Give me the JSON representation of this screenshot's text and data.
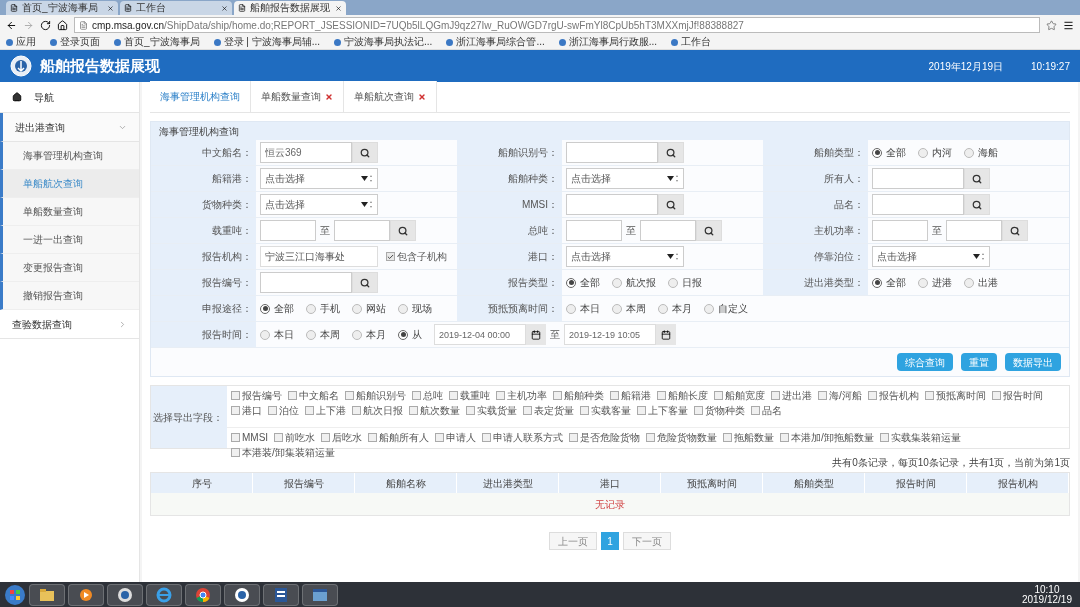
{
  "browser": {
    "tabs": [
      {
        "title": "首页_宁波海事局",
        "selected": false
      },
      {
        "title": "工作台",
        "selected": false
      },
      {
        "title": "船舶报告数据展现",
        "selected": true
      }
    ],
    "url_host": "cmp.msa.gov.cn",
    "url_path": "/ShipData/ship/home.do;REPORT_JSESSIONID=7UQb5lLQGmJ9qz27Iw_RuOWGD7rgU-swFmYl8CpUb5hT3MXXmjJf!88388827",
    "bookmarks": [
      "应用",
      "登录页面",
      "首页_宁波海事局",
      "登录 | 宁波海事局辅...",
      "宁波海事局执法记...",
      "浙江海事局综合管...",
      "浙江海事局行政服...",
      "工作台"
    ]
  },
  "header": {
    "title": "船舶报告数据展现",
    "date": "2019年12月19日",
    "time": "10:19:27"
  },
  "sidebar": {
    "nav_label": "导航",
    "items": [
      {
        "label": "进出港查询",
        "expanded": true,
        "children": [
          {
            "label": "海事管理机构查询",
            "selected": false
          },
          {
            "label": "单船航次查询",
            "selected": true
          },
          {
            "label": "单船数量查询",
            "selected": false
          },
          {
            "label": "一进一出查询",
            "selected": false
          },
          {
            "label": "变更报告查询",
            "selected": false
          },
          {
            "label": "撤销报告查询",
            "selected": false
          }
        ]
      },
      {
        "label": "查验数据查询",
        "expanded": false
      }
    ]
  },
  "tabs": [
    {
      "label": "海事管理机构查询",
      "selected": true,
      "closable": false
    },
    {
      "label": "单船数量查询",
      "selected": false,
      "closable": true
    },
    {
      "label": "单船航次查询",
      "selected": false,
      "closable": true
    }
  ],
  "query": {
    "title": "海事管理机构查询",
    "rows": [
      {
        "cells": [
          {
            "label": "中文船名：",
            "kind": "search",
            "value": "恒云369"
          },
          {
            "label": "船舶识别号：",
            "kind": "search"
          },
          {
            "label": "船舶类型：",
            "kind": "radio",
            "options": [
              {
                "label": "全部",
                "selected": true
              },
              {
                "label": "内河",
                "selected": false
              },
              {
                "label": "海船",
                "selected": false
              }
            ]
          }
        ]
      },
      {
        "cells": [
          {
            "label": "船籍港：",
            "kind": "select",
            "placeholder": "点击选择"
          },
          {
            "label": "船舶种类：",
            "kind": "select",
            "placeholder": "点击选择"
          },
          {
            "label": "所有人：",
            "kind": "search"
          }
        ]
      },
      {
        "cells": [
          {
            "label": "货物种类：",
            "kind": "select",
            "placeholder": "点击选择"
          },
          {
            "label": "MMSI：",
            "kind": "search"
          },
          {
            "label": "品名：",
            "kind": "search"
          }
        ]
      },
      {
        "cells": [
          {
            "label": "载重吨：",
            "kind": "range",
            "separator": "至"
          },
          {
            "label": "总吨：",
            "kind": "range",
            "separator": "至"
          },
          {
            "label": "主机功率：",
            "kind": "range",
            "separator": "至"
          }
        ]
      },
      {
        "cells": [
          {
            "label": "报告机构：",
            "kind": "org",
            "value": "宁波三江口海事处",
            "check_label": "包含子机构",
            "checked": true
          },
          {
            "label": "港口：",
            "kind": "select",
            "placeholder": "点击选择"
          },
          {
            "label": "停靠泊位：",
            "kind": "select",
            "placeholder": "点击选择"
          }
        ]
      },
      {
        "cells": [
          {
            "label": "报告编号：",
            "kind": "search"
          },
          {
            "label": "报告类型：",
            "kind": "radio",
            "options": [
              {
                "label": "全部",
                "selected": true
              },
              {
                "label": "航次报",
                "selected": false
              },
              {
                "label": "日报",
                "selected": false
              }
            ]
          },
          {
            "label": "进出港类型：",
            "kind": "radio",
            "options": [
              {
                "label": "全部",
                "selected": true
              },
              {
                "label": "进港",
                "selected": false
              },
              {
                "label": "出港",
                "selected": false
              }
            ]
          }
        ]
      },
      {
        "cells": [
          {
            "label": "申报途径：",
            "kind": "radio",
            "options": [
              {
                "label": "全部",
                "selected": true
              },
              {
                "label": "手机",
                "selected": false
              },
              {
                "label": "网站",
                "selected": false
              },
              {
                "label": "现场",
                "selected": false
              }
            ]
          },
          {
            "label": "预抵预离时间：",
            "kind": "radio",
            "options": [
              {
                "label": "本日",
                "selected": false
              },
              {
                "label": "本周",
                "selected": false
              },
              {
                "label": "本月",
                "selected": false
              },
              {
                "label": "自定义",
                "selected": false
              }
            ]
          }
        ]
      },
      {
        "cells": [
          {
            "label": "报告时间：",
            "kind": "timerange",
            "options": [
              {
                "label": "本日",
                "selected": false
              },
              {
                "label": "本周",
                "selected": false
              },
              {
                "label": "本月",
                "selected": false
              },
              {
                "label": "从",
                "selected": true
              }
            ],
            "from": "2019-12-04 00:00",
            "separator": "至",
            "to": "2019-12-19 10:05"
          }
        ]
      }
    ],
    "buttons": [
      "综合查询",
      "重置",
      "数据导出"
    ]
  },
  "export": {
    "label": "选择导出字段：",
    "groups": [
      [
        {
          "label": "报告编号",
          "checked": false
        },
        {
          "label": "中文船名",
          "checked": false
        },
        {
          "label": "船舶识别号",
          "checked": false
        },
        {
          "label": "总吨",
          "checked": false
        },
        {
          "label": "载重吨",
          "checked": false
        },
        {
          "label": "主机功率",
          "checked": false
        },
        {
          "label": "船舶种类",
          "checked": false
        },
        {
          "label": "船籍港",
          "checked": false
        },
        {
          "label": "船舶长度",
          "checked": false
        },
        {
          "label": "船舶宽度",
          "checked": false
        },
        {
          "label": "进出港",
          "checked": false
        },
        {
          "label": "海/河船",
          "checked": false
        },
        {
          "label": "报告机构",
          "checked": false
        },
        {
          "label": "预抵离时间",
          "checked": false
        },
        {
          "label": "报告时间",
          "checked": false
        },
        {
          "label": "港口",
          "checked": false
        },
        {
          "label": "泊位",
          "checked": false
        },
        {
          "label": "上下港",
          "checked": false
        },
        {
          "label": "航次日报",
          "checked": false
        },
        {
          "label": "航次数量",
          "checked": false
        },
        {
          "label": "实载货量",
          "checked": false
        },
        {
          "label": "表定货量",
          "checked": false
        },
        {
          "label": "实载客量",
          "checked": false
        },
        {
          "label": "上下客量",
          "checked": false
        },
        {
          "label": "货物种类",
          "checked": false
        },
        {
          "label": "品名",
          "checked": false
        }
      ],
      [
        {
          "label": "MMSI",
          "checked": false
        },
        {
          "label": "前吃水",
          "checked": false
        },
        {
          "label": "后吃水",
          "checked": false
        },
        {
          "label": "船舶所有人",
          "checked": false
        },
        {
          "label": "申请人",
          "checked": false
        },
        {
          "label": "申请人联系方式",
          "checked": false
        },
        {
          "label": "是否危险货物",
          "checked": false
        },
        {
          "label": "危险货物数量",
          "checked": false
        },
        {
          "label": "拖船数量",
          "checked": false
        },
        {
          "label": "本港加/卸拖船数量",
          "checked": false
        },
        {
          "label": "实载集装箱运量",
          "checked": false
        },
        {
          "label": "本港装/卸集装箱运量",
          "checked": false
        }
      ]
    ]
  },
  "results": {
    "summary": "共有0条记录，每页10条记录，共有1页，当前为第1页",
    "columns": [
      "序号",
      "报告编号",
      "船舶名称",
      "进出港类型",
      "港口",
      "预抵离时间",
      "船舶类型",
      "报告时间",
      "报告机构"
    ],
    "empty": "无记录"
  },
  "pagination": {
    "prev": "上一页",
    "pages": [
      {
        "label": "1",
        "selected": true
      }
    ],
    "next": "下一页"
  },
  "taskbar": {
    "time": "10:10",
    "date": "2019/12/19"
  }
}
